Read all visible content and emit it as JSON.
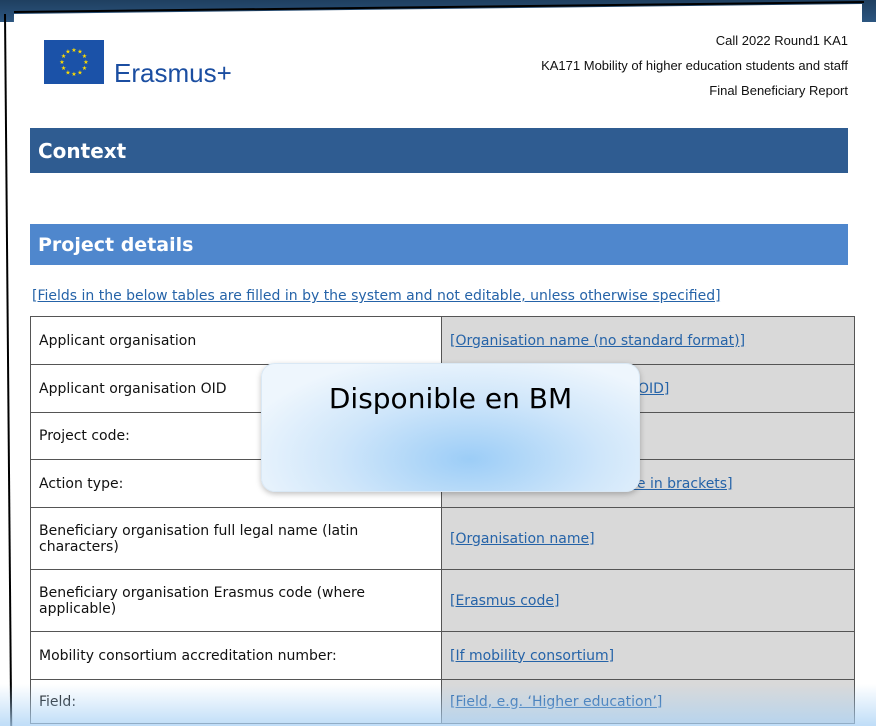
{
  "header": {
    "brand": "Erasmus+",
    "call": "Call 2022 Round1 KA1",
    "action": "KA171 Mobility of higher education students and staff",
    "report": "Final Beneficiary Report"
  },
  "sections": {
    "context": "Context",
    "project_details": "Project details"
  },
  "note": "[Fields in the below tables are filled in by the system and not editable, unless otherwise specified]",
  "table": {
    "rows": [
      {
        "label": "Applicant organisation",
        "value": "[Organisation name (no standard format)]"
      },
      {
        "label": "Applicant organisation OID",
        "value": "OID]"
      },
      {
        "label": "Project code:",
        "value": ""
      },
      {
        "label": "Action type:",
        "value": "de in brackets]"
      },
      {
        "label": "Beneficiary organisation full legal name (latin characters)",
        "value": "[Organisation name]"
      },
      {
        "label": "Beneficiary organisation Erasmus code (where applicable)",
        "value": "[Erasmus code]"
      },
      {
        "label": "Mobility consortium accreditation number:",
        "value": "[If mobility consortium]"
      },
      {
        "label": "Field:",
        "value": "[Field, e.g. ‘Higher education’]"
      }
    ]
  },
  "overlay": {
    "text": "Disponible en BM"
  },
  "colors": {
    "context_bar": "#2f5c91",
    "details_bar": "#4f87cd",
    "link": "#2563a8",
    "value_cell": "#d9d9d9"
  }
}
